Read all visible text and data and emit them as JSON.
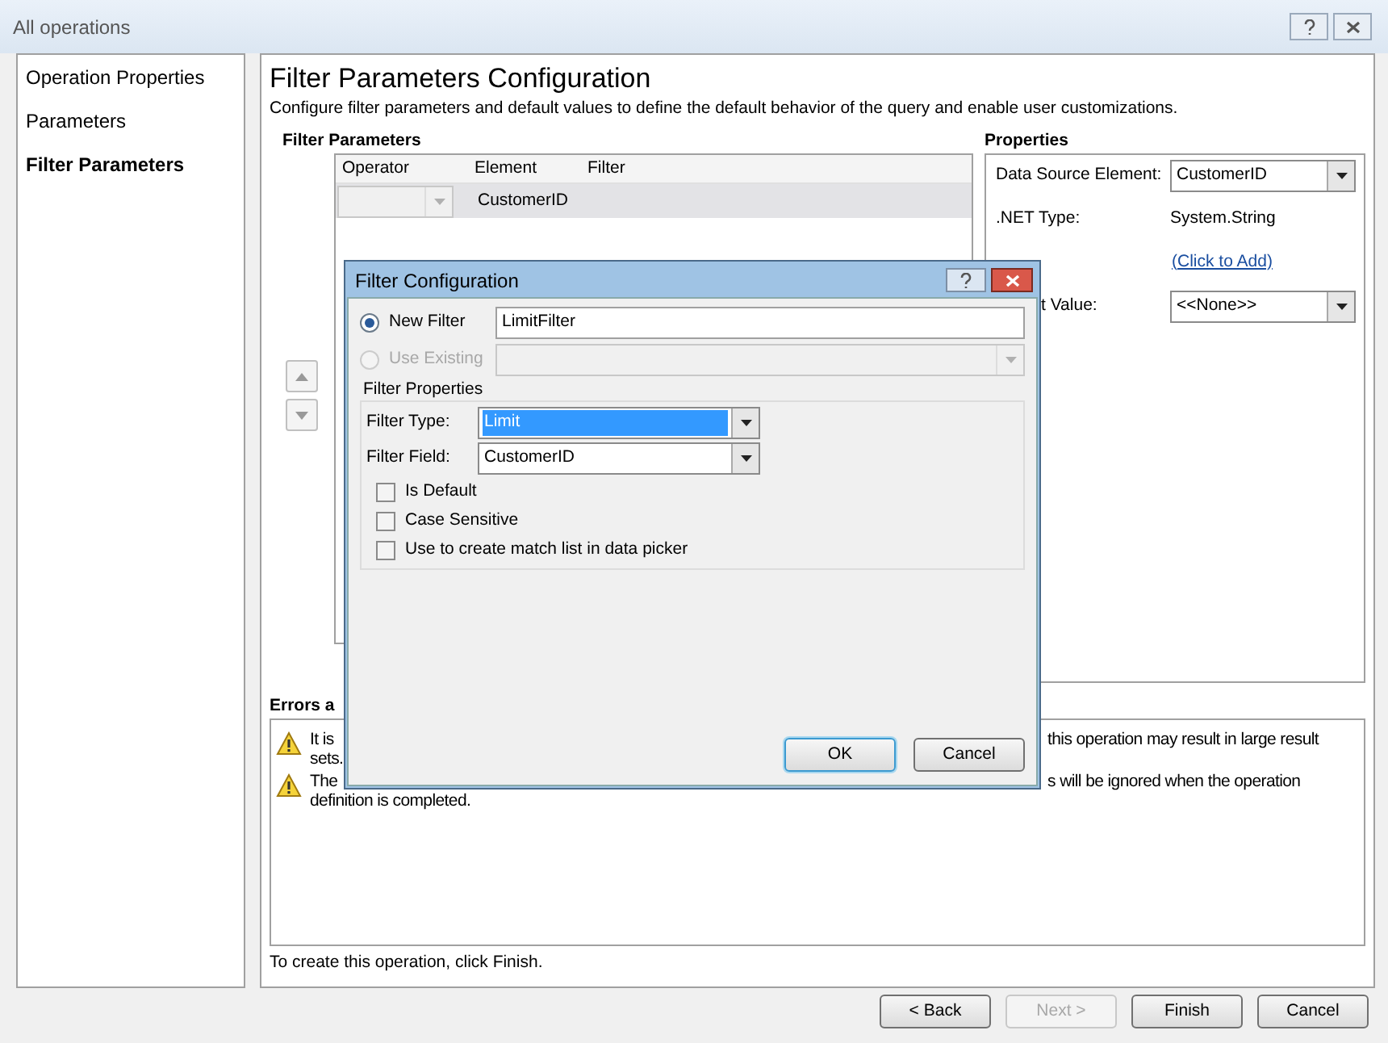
{
  "window": {
    "title": "All operations"
  },
  "sidebar": {
    "items": [
      {
        "label": "Operation Properties",
        "selected": false
      },
      {
        "label": "Parameters",
        "selected": false
      },
      {
        "label": "Filter Parameters",
        "selected": true
      }
    ]
  },
  "page": {
    "title": "Filter Parameters Configuration",
    "description": "Configure filter parameters and default values to define the default behavior of the query and enable user customizations."
  },
  "filter_parameters": {
    "heading": "Filter Parameters",
    "columns": [
      "Operator",
      "Element",
      "Filter"
    ],
    "rows": [
      {
        "element": "CustomerID",
        "selected": true
      }
    ]
  },
  "properties": {
    "heading": "Properties",
    "rows": [
      {
        "kind": "combo",
        "label": "Data Source Element:",
        "value": "CustomerID"
      },
      {
        "kind": "text",
        "label": ".NET Type:",
        "value": "System.String"
      },
      {
        "kind": "link",
        "value": "(Click to Add)"
      },
      {
        "kind": "combo",
        "label": "t Value:",
        "value": "<<None>>"
      }
    ]
  },
  "errors": {
    "heading": "Errors a",
    "messages": [
      {
        "left": "It is",
        "right": "this operation may result in large result",
        "continuation": "sets."
      },
      {
        "left": "The",
        "right": "s will be ignored when the operation",
        "continuation": "definition is completed."
      }
    ]
  },
  "footer_note": "To create this operation, click Finish.",
  "buttons": [
    {
      "label": "< Back",
      "disabled": false
    },
    {
      "label": "Next >",
      "disabled": true
    },
    {
      "label": "Finish",
      "disabled": false
    },
    {
      "label": "Cancel",
      "disabled": false
    }
  ],
  "dialog": {
    "title": "Filter Configuration",
    "options": [
      {
        "label": "New Filter",
        "selected": true,
        "disabled": false,
        "kind": "text",
        "value": "LimitFilter"
      },
      {
        "label": "Use Existing",
        "selected": false,
        "disabled": true,
        "kind": "combo"
      }
    ],
    "group": "Filter Properties",
    "fields": [
      {
        "label": "Filter Type:",
        "value": "Limit",
        "highlighted": true
      },
      {
        "label": "Filter Field:",
        "value": "CustomerID",
        "highlighted": false
      }
    ],
    "checkboxes": [
      {
        "label": "Is Default",
        "checked": false
      },
      {
        "label": "Case Sensitive",
        "checked": false
      },
      {
        "label": "Use to create match list in data picker",
        "checked": false
      }
    ],
    "buttons": [
      {
        "label": "OK",
        "default": true
      },
      {
        "label": "Cancel",
        "default": false
      }
    ]
  }
}
